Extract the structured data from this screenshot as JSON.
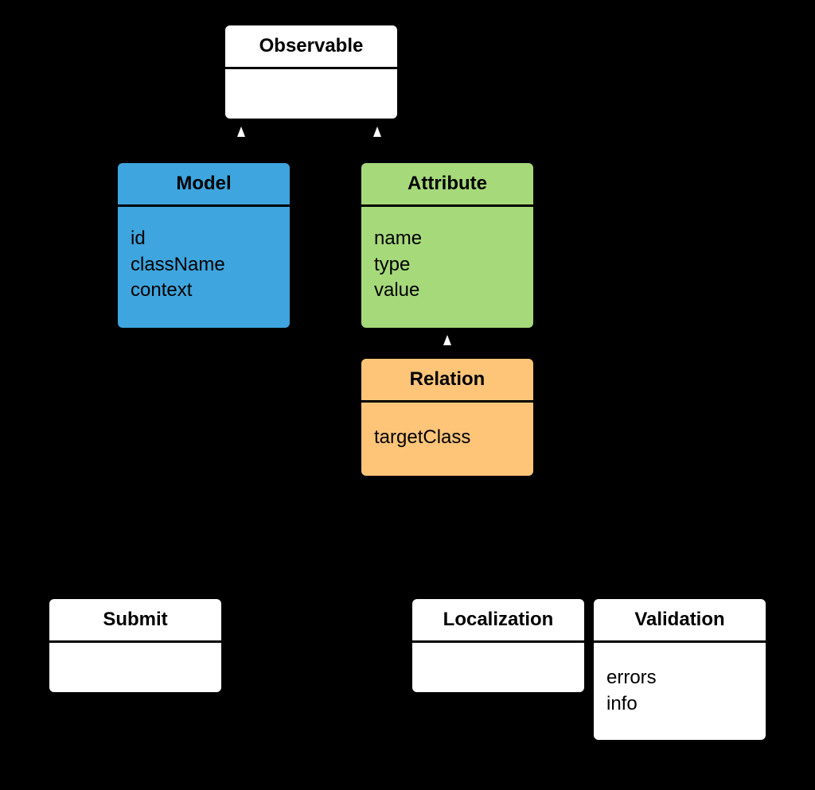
{
  "colors": {
    "background": "#000000",
    "default": "#ffffff",
    "model": "#3ea5de",
    "attribute": "#a6d97a",
    "relation": "#fec579"
  },
  "classes": {
    "observable": {
      "name": "Observable",
      "attributes": []
    },
    "model": {
      "name": "Model",
      "attributes": [
        "id",
        "className",
        "context"
      ]
    },
    "attribute": {
      "name": "Attribute",
      "attributes": [
        "name",
        "type",
        "value"
      ]
    },
    "relation": {
      "name": "Relation",
      "attributes": [
        "targetClass"
      ]
    },
    "submit": {
      "name": "Submit",
      "attributes": []
    },
    "localization": {
      "name": "Localization",
      "attributes": []
    },
    "validation": {
      "name": "Validation",
      "attributes": [
        "errors",
        "info"
      ]
    }
  },
  "relationships": [
    {
      "from": "Model",
      "to": "Observable",
      "type": "inheritance"
    },
    {
      "from": "Attribute",
      "to": "Observable",
      "type": "inheritance"
    },
    {
      "from": "Relation",
      "to": "Attribute",
      "type": "inheritance"
    }
  ]
}
